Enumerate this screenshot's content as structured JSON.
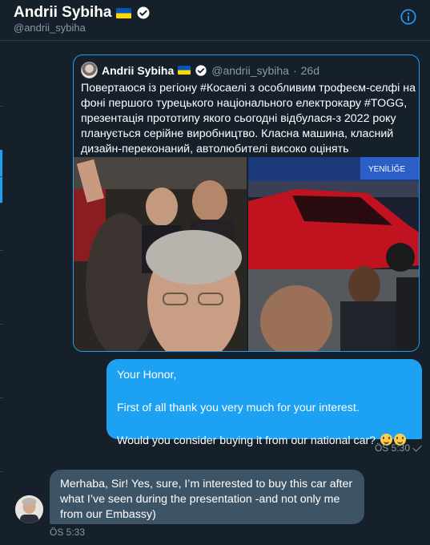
{
  "header": {
    "name": "Andrii Sybiha",
    "handle": "@andrii_sybiha"
  },
  "quoted_tweet": {
    "author_name": "Andrii Sybiha",
    "author_handle": "@andrii_sybiha",
    "separator": "·",
    "time": "26d",
    "text": "Повертаюся із регіону #Косаелі з особливим трофеєм-селфі на фоні першого турецького національного електрокару #TOGG, презентація прототипу якого сьогодні відбулася-з 2022 року планується серійне виробництво. Класна машина, класний дизайн-переконаний, автолюбителі високо оцінять",
    "photo_left_alt": "Selfie in a crowd at the car presentation",
    "photo_right_alt": "Red TOGG prototype car on display"
  },
  "messages": [
    {
      "direction": "outgoing",
      "lines": [
        "Your Honor,",
        "First of all thank you very much for your interest.",
        "Would you consider buying it from our national car?"
      ],
      "time": "ÖS 5:30"
    },
    {
      "direction": "incoming",
      "text": "Merhaba, Sir! Yes, sure, I’m interested to buy this car after what I’ve seen during the presentation -and not only me from our Embassy)",
      "time": "ÖS 5:33"
    }
  ],
  "icons": [
    "flag-ukraine-icon",
    "verified-icon",
    "info-icon",
    "read-check-icon",
    "smile-emoji-icon"
  ],
  "colors": {
    "background": "#15202b",
    "accent": "#1da1f2",
    "incoming_bubble": "#3d5466",
    "secondary_text": "#8899a6"
  }
}
